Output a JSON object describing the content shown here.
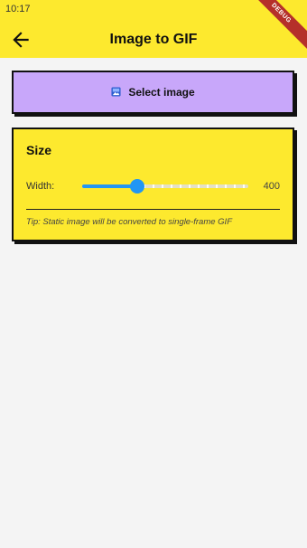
{
  "status_bar": {
    "time": "10:17"
  },
  "app_bar": {
    "title": "Image to GIF",
    "back_icon": "arrow-back-icon",
    "debug_banner": "DEBUG"
  },
  "select_button": {
    "label": "Select image",
    "icon": "image-icon",
    "color": "#c8a7fa"
  },
  "size_card": {
    "title": "Size",
    "width_label": "Width:",
    "width_value": "400",
    "slider_fraction": 0.33,
    "tip": "Tip: Static image will be converted to single-frame GIF"
  },
  "colors": {
    "accent": "#fde92e",
    "slider": "#2196f3",
    "button": "#c8a7fa",
    "background": "#f4f4f4"
  }
}
